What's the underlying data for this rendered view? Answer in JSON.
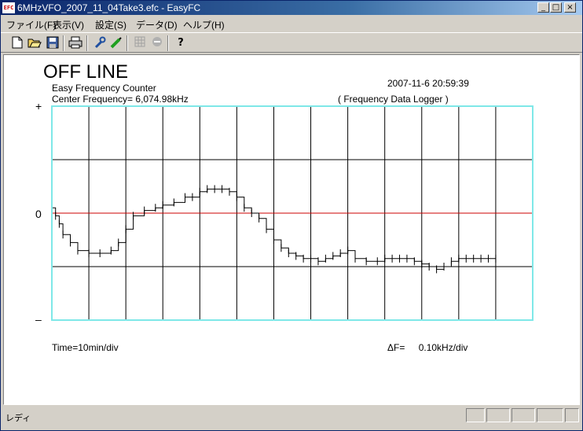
{
  "window": {
    "title": "6MHzVFO_2007_11_04Take3.efc - EasyFC",
    "icon_label": "EFC",
    "minimize_glyph": "_",
    "maximize_glyph": "□",
    "close_glyph": "×"
  },
  "menu": [
    "ファイル(F)",
    "表示(V)",
    "設定(S)",
    "データ(D)",
    "ヘルプ(H)"
  ],
  "toolbar": {
    "new_icon": "new-file-icon",
    "open_icon": "open-folder-icon",
    "save_icon": "save-disk-icon",
    "print_icon": "printer-icon",
    "settings_icon": "wrench-icon",
    "pen_icon": "pen-icon",
    "grid_icon": "grid-icon",
    "stop_icon": "stop-circle-icon",
    "help_icon": "help-question-icon",
    "help_glyph": "?"
  },
  "display": {
    "status": "OFF LINE",
    "app_name": "Easy Frequency Counter",
    "center_label": "Center Frequency=",
    "center_value": "6,074.98kHz",
    "datetime": "2007-11-6  20:59:39",
    "mode": "( Frequency Data Logger )",
    "plus_label": "+",
    "zero_label": "0",
    "minus_label": "–",
    "time_scale": "Time=10min/div",
    "delta_label": "ΔF=",
    "delta_value": "0.10kHz/div"
  },
  "chart_data": {
    "type": "line",
    "x_unit": "min",
    "y_unit": "kHz offset from center",
    "xlim": [
      0,
      130
    ],
    "ylim": [
      -0.2,
      0.2
    ],
    "grid": true,
    "x": [
      0,
      1,
      2,
      3,
      5,
      7,
      10,
      13,
      16,
      18,
      20,
      22,
      25,
      28,
      30,
      33,
      36,
      38,
      40,
      42,
      44,
      46,
      48,
      50,
      52,
      54,
      56,
      58,
      60,
      62,
      64,
      66,
      68,
      70,
      72,
      74,
      76,
      78,
      80,
      82,
      85,
      88,
      90,
      92,
      94,
      96,
      98,
      100,
      102,
      104,
      106,
      108,
      110,
      112,
      114,
      116,
      118,
      120
    ],
    "values": [
      0.01,
      -0.005,
      -0.02,
      -0.04,
      -0.055,
      -0.07,
      -0.075,
      -0.075,
      -0.07,
      -0.055,
      -0.03,
      -0.005,
      0.005,
      0.01,
      0.015,
      0.02,
      0.03,
      0.03,
      0.04,
      0.045,
      0.045,
      0.045,
      0.04,
      0.03,
      0.01,
      0.0,
      -0.01,
      -0.03,
      -0.05,
      -0.065,
      -0.075,
      -0.08,
      -0.085,
      -0.085,
      -0.09,
      -0.085,
      -0.08,
      -0.075,
      -0.07,
      -0.085,
      -0.09,
      -0.09,
      -0.085,
      -0.085,
      -0.085,
      -0.085,
      -0.09,
      -0.095,
      -0.1,
      -0.105,
      -0.1,
      -0.09,
      -0.085,
      -0.085,
      -0.085,
      -0.085,
      -0.085,
      -0.085
    ],
    "trace_color": "#000000",
    "zero_line_color": "#cc0000",
    "frame_color": "#7fe8e8",
    "grid_color": "#000000"
  },
  "statusbar": {
    "text": "レディ"
  }
}
